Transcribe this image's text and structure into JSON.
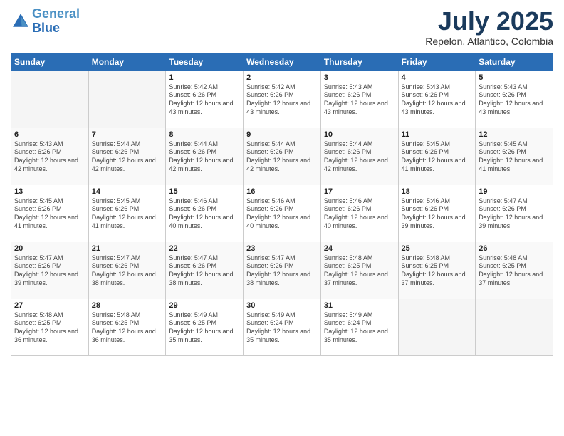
{
  "header": {
    "logo_line1": "General",
    "logo_line2": "Blue",
    "main_title": "July 2025",
    "subtitle": "Repelon, Atlantico, Colombia"
  },
  "calendar": {
    "days_of_week": [
      "Sunday",
      "Monday",
      "Tuesday",
      "Wednesday",
      "Thursday",
      "Friday",
      "Saturday"
    ],
    "weeks": [
      [
        {
          "day": "",
          "info": ""
        },
        {
          "day": "",
          "info": ""
        },
        {
          "day": "1",
          "info": "Sunrise: 5:42 AM\nSunset: 6:26 PM\nDaylight: 12 hours and 43 minutes."
        },
        {
          "day": "2",
          "info": "Sunrise: 5:42 AM\nSunset: 6:26 PM\nDaylight: 12 hours and 43 minutes."
        },
        {
          "day": "3",
          "info": "Sunrise: 5:43 AM\nSunset: 6:26 PM\nDaylight: 12 hours and 43 minutes."
        },
        {
          "day": "4",
          "info": "Sunrise: 5:43 AM\nSunset: 6:26 PM\nDaylight: 12 hours and 43 minutes."
        },
        {
          "day": "5",
          "info": "Sunrise: 5:43 AM\nSunset: 6:26 PM\nDaylight: 12 hours and 43 minutes."
        }
      ],
      [
        {
          "day": "6",
          "info": "Sunrise: 5:43 AM\nSunset: 6:26 PM\nDaylight: 12 hours and 42 minutes."
        },
        {
          "day": "7",
          "info": "Sunrise: 5:44 AM\nSunset: 6:26 PM\nDaylight: 12 hours and 42 minutes."
        },
        {
          "day": "8",
          "info": "Sunrise: 5:44 AM\nSunset: 6:26 PM\nDaylight: 12 hours and 42 minutes."
        },
        {
          "day": "9",
          "info": "Sunrise: 5:44 AM\nSunset: 6:26 PM\nDaylight: 12 hours and 42 minutes."
        },
        {
          "day": "10",
          "info": "Sunrise: 5:44 AM\nSunset: 6:26 PM\nDaylight: 12 hours and 42 minutes."
        },
        {
          "day": "11",
          "info": "Sunrise: 5:45 AM\nSunset: 6:26 PM\nDaylight: 12 hours and 41 minutes."
        },
        {
          "day": "12",
          "info": "Sunrise: 5:45 AM\nSunset: 6:26 PM\nDaylight: 12 hours and 41 minutes."
        }
      ],
      [
        {
          "day": "13",
          "info": "Sunrise: 5:45 AM\nSunset: 6:26 PM\nDaylight: 12 hours and 41 minutes."
        },
        {
          "day": "14",
          "info": "Sunrise: 5:45 AM\nSunset: 6:26 PM\nDaylight: 12 hours and 41 minutes."
        },
        {
          "day": "15",
          "info": "Sunrise: 5:46 AM\nSunset: 6:26 PM\nDaylight: 12 hours and 40 minutes."
        },
        {
          "day": "16",
          "info": "Sunrise: 5:46 AM\nSunset: 6:26 PM\nDaylight: 12 hours and 40 minutes."
        },
        {
          "day": "17",
          "info": "Sunrise: 5:46 AM\nSunset: 6:26 PM\nDaylight: 12 hours and 40 minutes."
        },
        {
          "day": "18",
          "info": "Sunrise: 5:46 AM\nSunset: 6:26 PM\nDaylight: 12 hours and 39 minutes."
        },
        {
          "day": "19",
          "info": "Sunrise: 5:47 AM\nSunset: 6:26 PM\nDaylight: 12 hours and 39 minutes."
        }
      ],
      [
        {
          "day": "20",
          "info": "Sunrise: 5:47 AM\nSunset: 6:26 PM\nDaylight: 12 hours and 39 minutes."
        },
        {
          "day": "21",
          "info": "Sunrise: 5:47 AM\nSunset: 6:26 PM\nDaylight: 12 hours and 38 minutes."
        },
        {
          "day": "22",
          "info": "Sunrise: 5:47 AM\nSunset: 6:26 PM\nDaylight: 12 hours and 38 minutes."
        },
        {
          "day": "23",
          "info": "Sunrise: 5:47 AM\nSunset: 6:26 PM\nDaylight: 12 hours and 38 minutes."
        },
        {
          "day": "24",
          "info": "Sunrise: 5:48 AM\nSunset: 6:25 PM\nDaylight: 12 hours and 37 minutes."
        },
        {
          "day": "25",
          "info": "Sunrise: 5:48 AM\nSunset: 6:25 PM\nDaylight: 12 hours and 37 minutes."
        },
        {
          "day": "26",
          "info": "Sunrise: 5:48 AM\nSunset: 6:25 PM\nDaylight: 12 hours and 37 minutes."
        }
      ],
      [
        {
          "day": "27",
          "info": "Sunrise: 5:48 AM\nSunset: 6:25 PM\nDaylight: 12 hours and 36 minutes."
        },
        {
          "day": "28",
          "info": "Sunrise: 5:48 AM\nSunset: 6:25 PM\nDaylight: 12 hours and 36 minutes."
        },
        {
          "day": "29",
          "info": "Sunrise: 5:49 AM\nSunset: 6:25 PM\nDaylight: 12 hours and 35 minutes."
        },
        {
          "day": "30",
          "info": "Sunrise: 5:49 AM\nSunset: 6:24 PM\nDaylight: 12 hours and 35 minutes."
        },
        {
          "day": "31",
          "info": "Sunrise: 5:49 AM\nSunset: 6:24 PM\nDaylight: 12 hours and 35 minutes."
        },
        {
          "day": "",
          "info": ""
        },
        {
          "day": "",
          "info": ""
        }
      ]
    ]
  }
}
